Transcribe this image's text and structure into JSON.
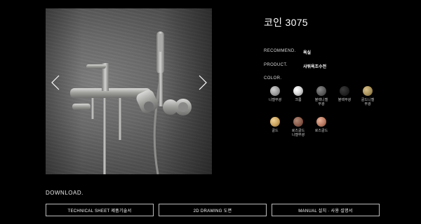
{
  "product": {
    "title": "코인 3075",
    "recommend_label": "RECOMMEND.",
    "recommend_value": "욕실",
    "product_label": "PRODUCT.",
    "product_value": "샤워욕조수전",
    "color_label": "COLOR."
  },
  "gallery": {
    "prev_icon": "chevron-left-icon",
    "next_icon": "chevron-right-icon"
  },
  "colors": [
    {
      "name": "니켈무광",
      "hex": "#9a9a9a"
    },
    {
      "name": "크롬",
      "hex": "#d8d8d8"
    },
    {
      "name": "블랙니켈\n무광",
      "hex": "#5a5a5a"
    },
    {
      "name": "블랙무광",
      "hex": "#1e1e1e"
    },
    {
      "name": "골드니켈\n무광",
      "hex": "#a8915a"
    },
    {
      "name": "골드",
      "hex": "#c9a25c"
    },
    {
      "name": "로즈골드\n니켈무광",
      "hex": "#8a5a4a"
    },
    {
      "name": "로즈골드",
      "hex": "#b97a62"
    }
  ],
  "download": {
    "label": "DOWNLOAD.",
    "buttons": [
      "TECHNICAL SHEET 제품기술서",
      "2D DRAWING 도면",
      "MANUAL 설치 · 사용 설명서"
    ]
  }
}
